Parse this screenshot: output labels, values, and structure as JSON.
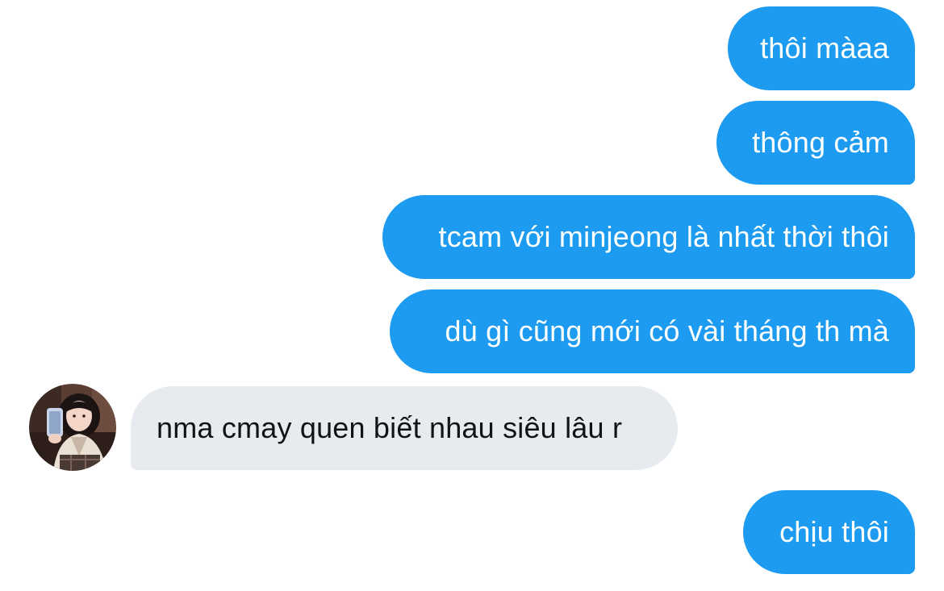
{
  "conversation": {
    "messages": [
      {
        "sender": "self",
        "text": "thôi màaa"
      },
      {
        "sender": "self",
        "text": "thông cảm"
      },
      {
        "sender": "self",
        "text": "tcam với minjeong là nhất thời thôi"
      },
      {
        "sender": "self",
        "text": "dù gì cũng mới có vài tháng th mà"
      },
      {
        "sender": "other",
        "text": "nma cmay quen biết nhau siêu lâu r"
      },
      {
        "sender": "self",
        "text": "chịu thôi"
      }
    ]
  },
  "colors": {
    "outgoing_bubble": "#1d9bf0",
    "incoming_bubble": "#e7ebef",
    "outgoing_text": "#ffffff",
    "incoming_text": "#0f1419",
    "background": "#ffffff"
  },
  "icons": {
    "contact_avatar": "user-avatar-photo"
  }
}
